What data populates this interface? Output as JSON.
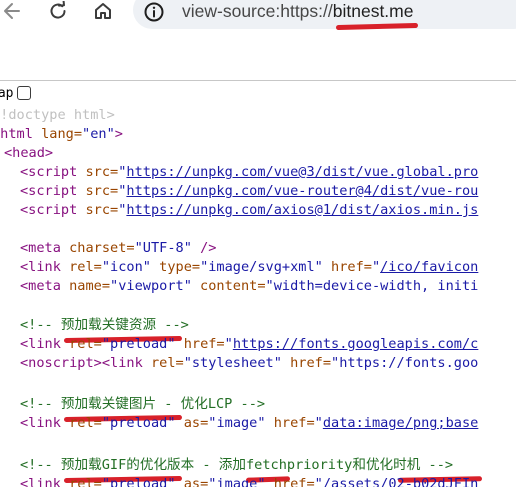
{
  "browser": {
    "url_prefix": "view-source:https://",
    "url_host": "bitnest.me"
  },
  "wrap": {
    "label": "rap"
  },
  "source_lines": {
    "l1": {
      "text": "doctype html>"
    },
    "l2": {
      "tag_open": "tml",
      "attr": " lang=",
      "val": "\"en\"",
      "close": ">"
    },
    "l3": {
      "tag": "<head>"
    },
    "l4": {
      "tag": "<script",
      "attr": " src=",
      "quote": "\"",
      "link": "https://unpkg.com/vue@3/dist/vue.global.pro"
    },
    "l5": {
      "tag": "<script",
      "attr": " src=",
      "quote": "\"",
      "link": "https://unpkg.com/vue-router@4/dist/vue-rou"
    },
    "l6": {
      "tag": "<script",
      "attr": " src=",
      "quote": "\"",
      "link": "https://unpkg.com/axios@1/dist/axios.min.js"
    },
    "l7": {
      "tag": "<meta",
      "attr": " charset=",
      "val": "\"UTF-8\"",
      "close": " />"
    },
    "l8": {
      "tag": "<link",
      "attr1": " rel=",
      "val1": "\"icon\"",
      "attr2": " type=",
      "val2": "\"image/svg+xml\"",
      "attr3": " href=",
      "quote": "\"",
      "link": "/ico/favicon"
    },
    "l9": {
      "tag": "<meta",
      "attr1": " name=",
      "val1": "\"viewport\"",
      "attr2": " content=",
      "val2": "\"width=device-width, initi"
    },
    "l10": {
      "comment": "<!-- 预加载关键资源 -->"
    },
    "l11": {
      "tag": "<link",
      "attr1": " rel=",
      "val1": "\"preload\"",
      "attr2": " href=",
      "quote": "\"",
      "link": "https://fonts.googleapis.com/c"
    },
    "l12": {
      "tag": "<noscript>",
      "tag2": "<link",
      "attr": " rel=",
      "val": "\"stylesheet\"",
      "attr2": " href=",
      "val2": "\"https://fonts.goo"
    },
    "l13": {
      "comment": "<!-- 预加载关键图片 - 优化LCP -->"
    },
    "l14": {
      "tag": "<link",
      "attr1": " rel=",
      "val1": "\"preload\"",
      "attr2": " as=",
      "val2": "\"image\"",
      "attr3": " href=",
      "quote": "\"",
      "link": "data:image/png;base"
    },
    "l15": {
      "comment": "<!-- 预加载GIF的优化版本 - 添加fetchpriority和优化时机 -->"
    },
    "l16": {
      "tag": "<link",
      "attr1": " rel=",
      "val1": "\"preload\"",
      "attr2": " as=",
      "val2": "\"image\"",
      "attr3": " href=",
      "quote": "\"",
      "link": "/assets/02-b02dJFIn"
    }
  },
  "colors": {
    "tag": "#881280",
    "attribute": "#994500",
    "value": "#1a1aa6",
    "comment": "#236e25",
    "annotation": "#d8212a"
  },
  "icons": [
    "back-arrow-icon",
    "reload-icon",
    "home-icon",
    "site-info-icon"
  ]
}
